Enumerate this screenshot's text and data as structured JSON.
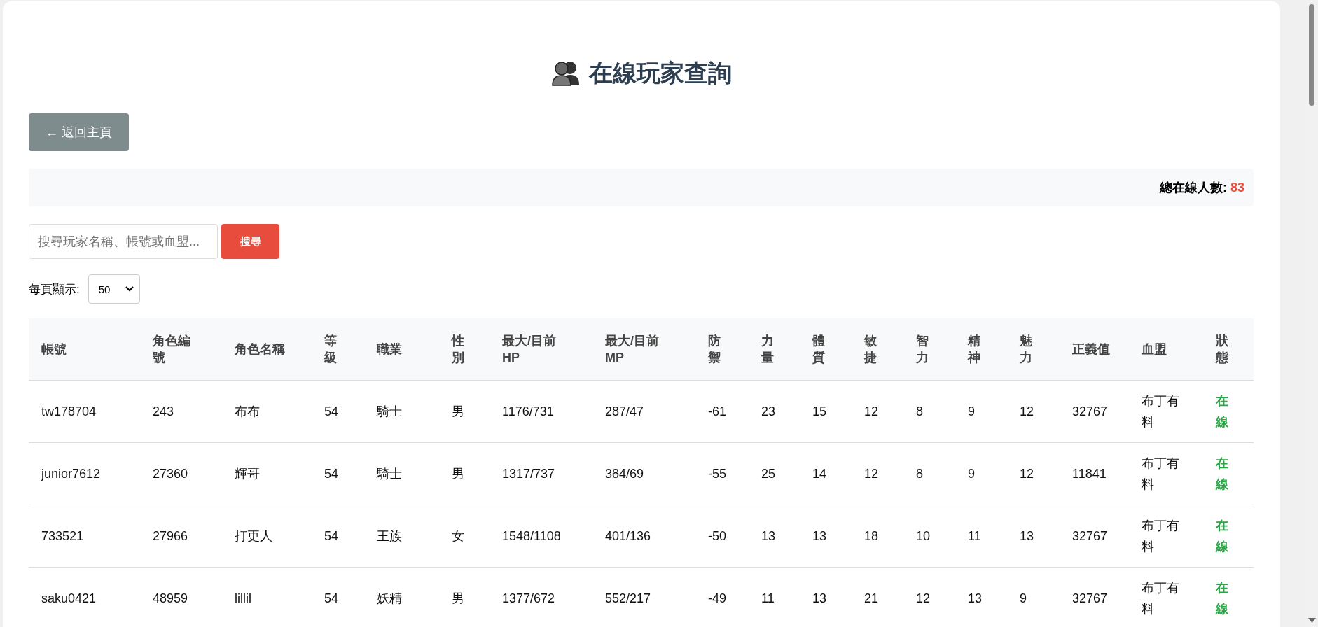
{
  "title": "在線玩家查詢",
  "back_button": "← 返回主頁",
  "stats": {
    "label": "總在線人數:",
    "value": "83"
  },
  "search": {
    "placeholder": "搜尋玩家名稱、帳號或血盟...",
    "button": "搜尋"
  },
  "page_size": {
    "label": "每頁顯示:",
    "value": "50"
  },
  "table": {
    "columns": [
      "帳號",
      "角色編號",
      "角色名稱",
      "等級",
      "職業",
      "性別",
      "最大/目前HP",
      "最大/目前MP",
      "防禦",
      "力量",
      "體質",
      "敏捷",
      "智力",
      "精神",
      "魅力",
      "正義值",
      "血盟",
      "狀態"
    ],
    "rows": [
      [
        "tw178704",
        "243",
        "布布",
        "54",
        "騎士",
        "男",
        "1176/731",
        "287/47",
        "-61",
        "23",
        "15",
        "12",
        "8",
        "9",
        "12",
        "32767",
        "布丁有料",
        "在線"
      ],
      [
        "junior7612",
        "27360",
        "輝哥",
        "54",
        "騎士",
        "男",
        "1317/737",
        "384/69",
        "-55",
        "25",
        "14",
        "12",
        "8",
        "9",
        "12",
        "11841",
        "布丁有料",
        "在線"
      ],
      [
        "733521",
        "27966",
        "打更人",
        "54",
        "王族",
        "女",
        "1548/1108",
        "401/136",
        "-50",
        "13",
        "13",
        "18",
        "10",
        "11",
        "13",
        "32767",
        "布丁有料",
        "在線"
      ],
      [
        "saku0421",
        "48959",
        "lillil",
        "54",
        "妖精",
        "男",
        "1377/672",
        "552/217",
        "-49",
        "11",
        "13",
        "21",
        "12",
        "13",
        "9",
        "32767",
        "布丁有料",
        "在線"
      ]
    ]
  }
}
